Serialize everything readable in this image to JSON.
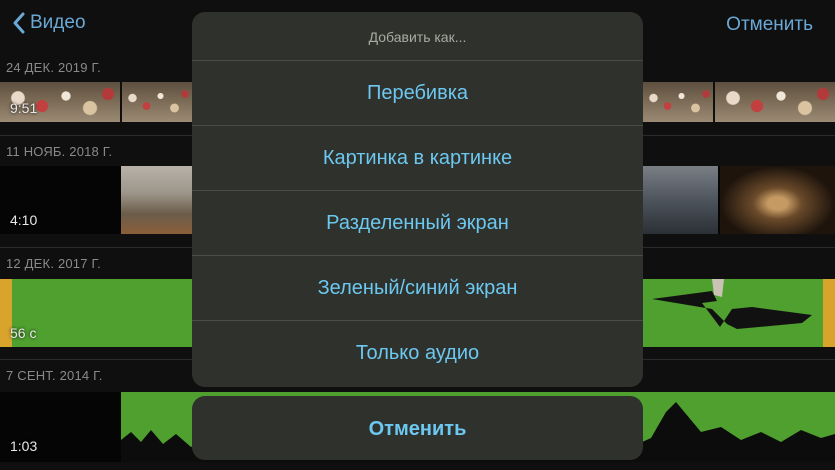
{
  "nav": {
    "back_label": "Видео",
    "cancel_label": "Отменить"
  },
  "sections": [
    {
      "date": "24 ДЕК. 2019 Г.",
      "duration": "9:51"
    },
    {
      "date": "11 НОЯБ. 2018 Г.",
      "duration": "4:10"
    },
    {
      "date": "12 ДЕК. 2017 Г.",
      "duration": "56 с"
    },
    {
      "date": "7 СЕНТ. 2014 Г.",
      "duration": "1:03"
    }
  ],
  "sheet": {
    "title": "Добавить как...",
    "options": [
      "Перебивка",
      "Картинка в картинке",
      "Разделенный экран",
      "Зеленый/синий экран",
      "Только аудио"
    ],
    "cancel": "Отменить"
  },
  "colors": {
    "accent": "#6cc8f0",
    "nav_tint": "#6aa8d6",
    "selected_clip_border": "#d8a42c",
    "green_screen": "#4fa02f"
  },
  "icons": {
    "back": "chevron-left-icon"
  }
}
